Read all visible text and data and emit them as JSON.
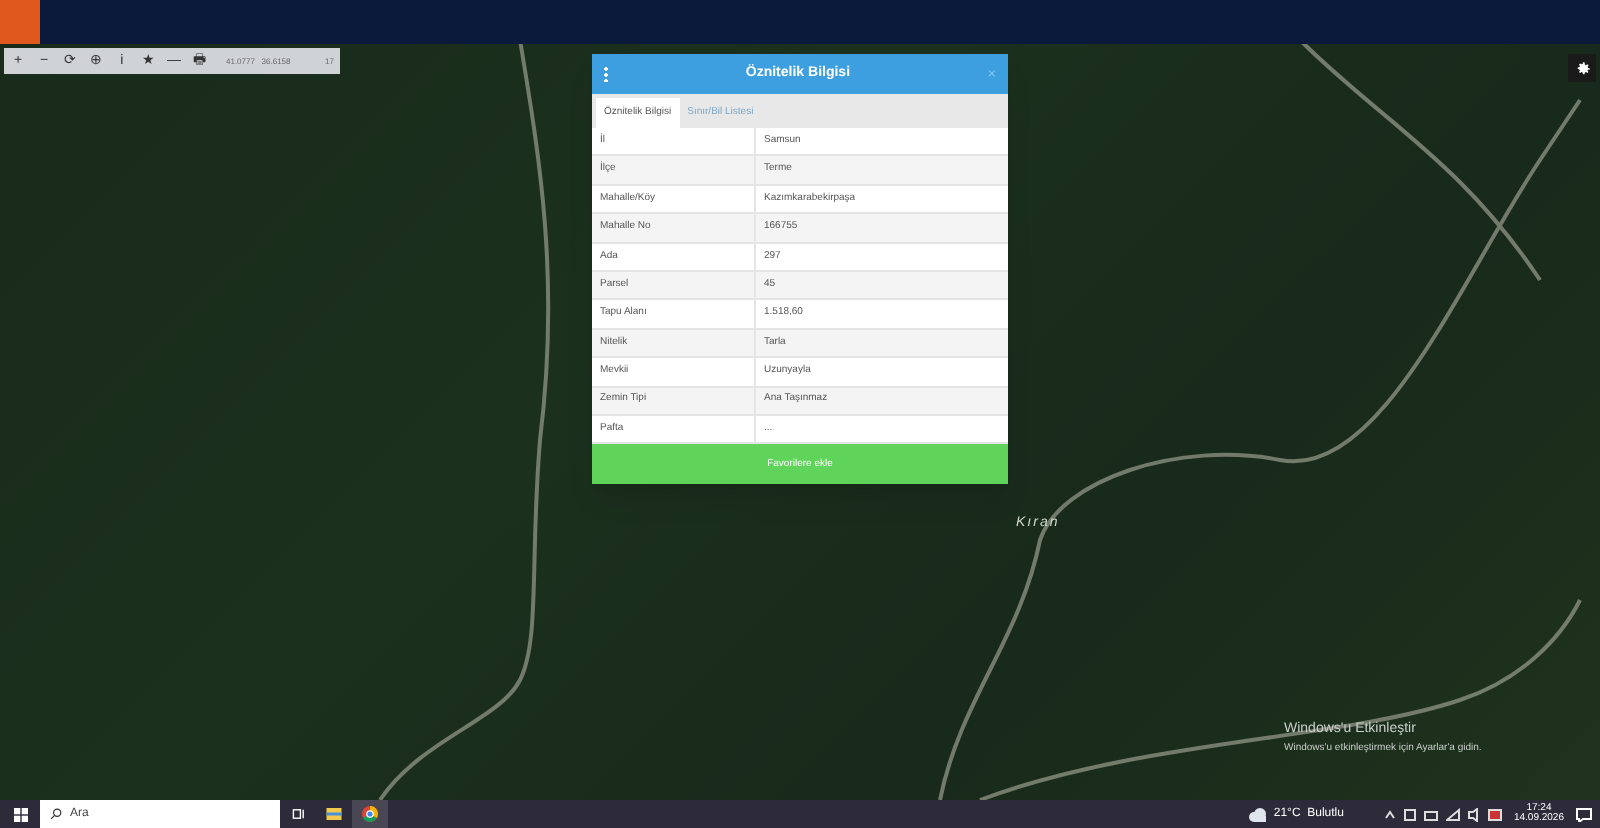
{
  "toolbar": {
    "tools": [
      "+",
      "−",
      "⟳",
      "⊕",
      "ℹ",
      "★",
      "—",
      "🖶"
    ],
    "coordinates": "41.0777   36.6158",
    "zoom": "17"
  },
  "dialog": {
    "title": "Öznitelik Bilgisi",
    "close": "×",
    "tabs": [
      {
        "label": "Öznitelik Bilgisi",
        "selected": true
      },
      {
        "label": "Sınır/Bil Listesi",
        "selected": false
      }
    ],
    "rows": [
      {
        "label": "İl",
        "value": "Samsun"
      },
      {
        "label": "İlçe",
        "value": "Terme"
      },
      {
        "label": "Mahalle/Köy",
        "value": "Kazımkarabekirpaşa"
      },
      {
        "label": "Mahalle No",
        "value": "166755"
      },
      {
        "label": "Ada",
        "value": "297"
      },
      {
        "label": "Parsel",
        "value": "45"
      },
      {
        "label": "Tapu Alanı",
        "value": "1.518,60"
      },
      {
        "label": "Nitelik",
        "value": "Tarla"
      },
      {
        "label": "Mevkii",
        "value": "Uzunyayla"
      },
      {
        "label": "Zemin Tipi",
        "value": "Ana Taşınmaz"
      },
      {
        "label": "Pafta",
        "value": "..."
      }
    ],
    "action": "Favorilere ekle"
  },
  "map_label": "Kıran",
  "activation": {
    "title": "Windows'u Etkinleştir",
    "text": "Windows'u etkinleştirmek için Ayarlar'a gidin."
  },
  "taskbar": {
    "search_placeholder": "Ara",
    "weather": "21°C  Bulutlu",
    "time": "17:24",
    "date": "14.09.2026"
  }
}
